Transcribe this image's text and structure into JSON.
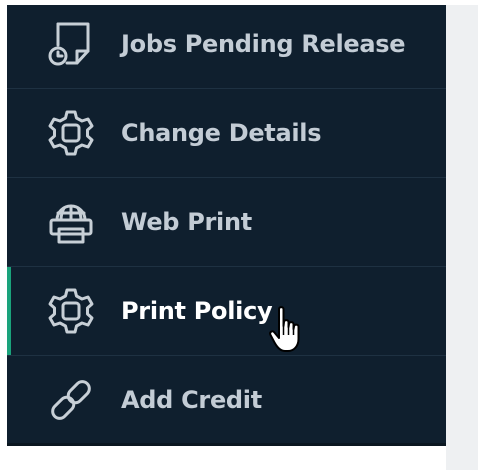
{
  "colors": {
    "sidebar_bg": "#0f1f2e",
    "label_default": "#c3ccd5",
    "label_active": "#ffffff",
    "icon_color": "#c7cfd6",
    "active_accent": "#1aa37c",
    "divider": "#1e3142"
  },
  "menu": {
    "items": [
      {
        "label": "Jobs Pending Release",
        "icon": "print-release-icon",
        "active": false
      },
      {
        "label": "Change Details",
        "icon": "gear-icon",
        "active": false
      },
      {
        "label": "Web Print",
        "icon": "printer-globe-icon",
        "active": false
      },
      {
        "label": "Print Policy",
        "icon": "gear-icon",
        "active": true
      },
      {
        "label": "Add Credit",
        "icon": "link-icon",
        "active": false
      }
    ]
  },
  "cursor": {
    "icon": "hand-pointer-icon"
  }
}
